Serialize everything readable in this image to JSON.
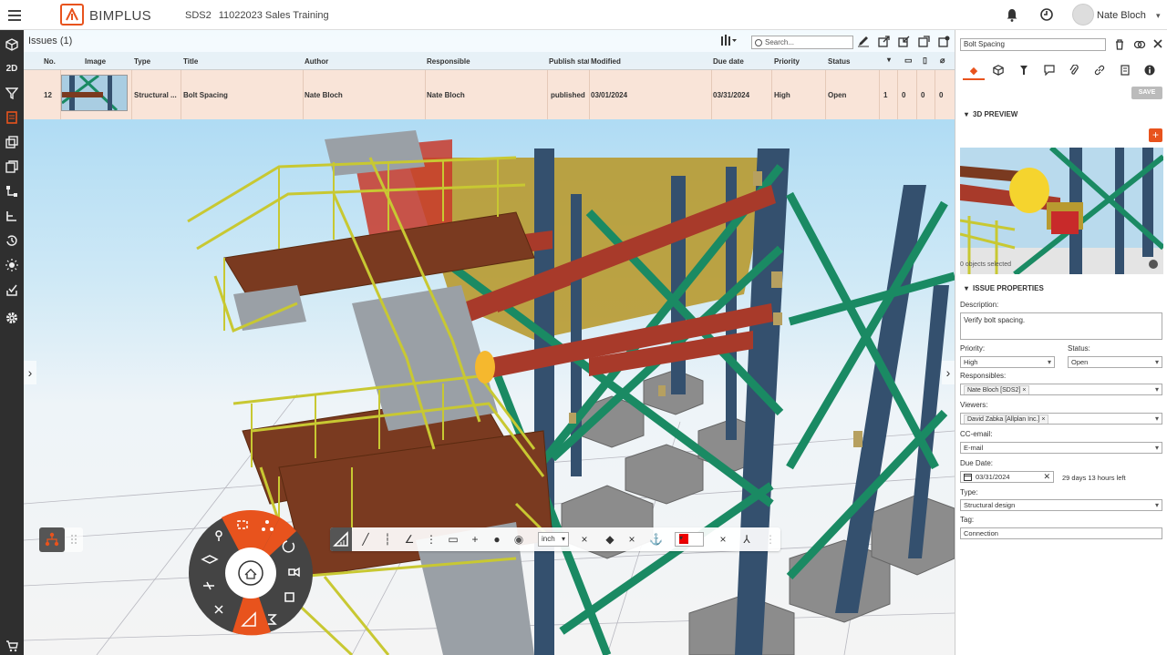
{
  "app": {
    "brand": "BIMPLUS",
    "project_code": "SDS2",
    "project_name": "11022023 Sales Training",
    "user_name": "Nate Bloch"
  },
  "issues_panel": {
    "title": "Issues (1)",
    "search_placeholder": "Search...",
    "columns": [
      "No.",
      "Image",
      "Type",
      "Title",
      "Author",
      "Responsible",
      "Publish stat",
      "Modified",
      "Due date",
      "Priority",
      "Status"
    ],
    "rows": [
      {
        "no": "12",
        "type": "Structural ...",
        "title": "Bolt Spacing",
        "author": "Nate Bloch",
        "responsible": "Nate Bloch",
        "publish_status": "published",
        "modified": "03/01/2024",
        "due_date": "03/31/2024",
        "priority": "High",
        "status": "Open",
        "pins": "1",
        "comments": "0",
        "docs": "0",
        "attachments": "0"
      }
    ]
  },
  "issue_detail": {
    "title": "Bolt Spacing",
    "save_label": "SAVE",
    "preview_section": "3D PREVIEW",
    "objects_selected": "0 objects selected",
    "properties_section": "ISSUE PROPERTIES",
    "description_label": "Description:",
    "description": "Verify bolt spacing.",
    "priority_label": "Priority:",
    "priority": "High",
    "status_label": "Status:",
    "status": "Open",
    "responsibles_label": "Responsibles:",
    "responsible_chip": "Nate Bloch [SDS2]",
    "viewers_label": "Viewers:",
    "viewer_chip": "David Zabka [Allplan Inc.]",
    "cc_label": "CC-email:",
    "cc_value": "E-mail",
    "due_label": "Due Date:",
    "due_value": "03/31/2024",
    "due_remaining": "29 days 13 hours left",
    "type_label": "Type:",
    "type_value": "Structural design",
    "tag_label": "Tag:",
    "tag_value": "Connection"
  },
  "measure_bar": {
    "unit": "inch",
    "color": "#e00000"
  },
  "colors": {
    "accent": "#e8531d",
    "sidebar": "#2f2f2f",
    "row_highlight": "#fce4d6"
  }
}
